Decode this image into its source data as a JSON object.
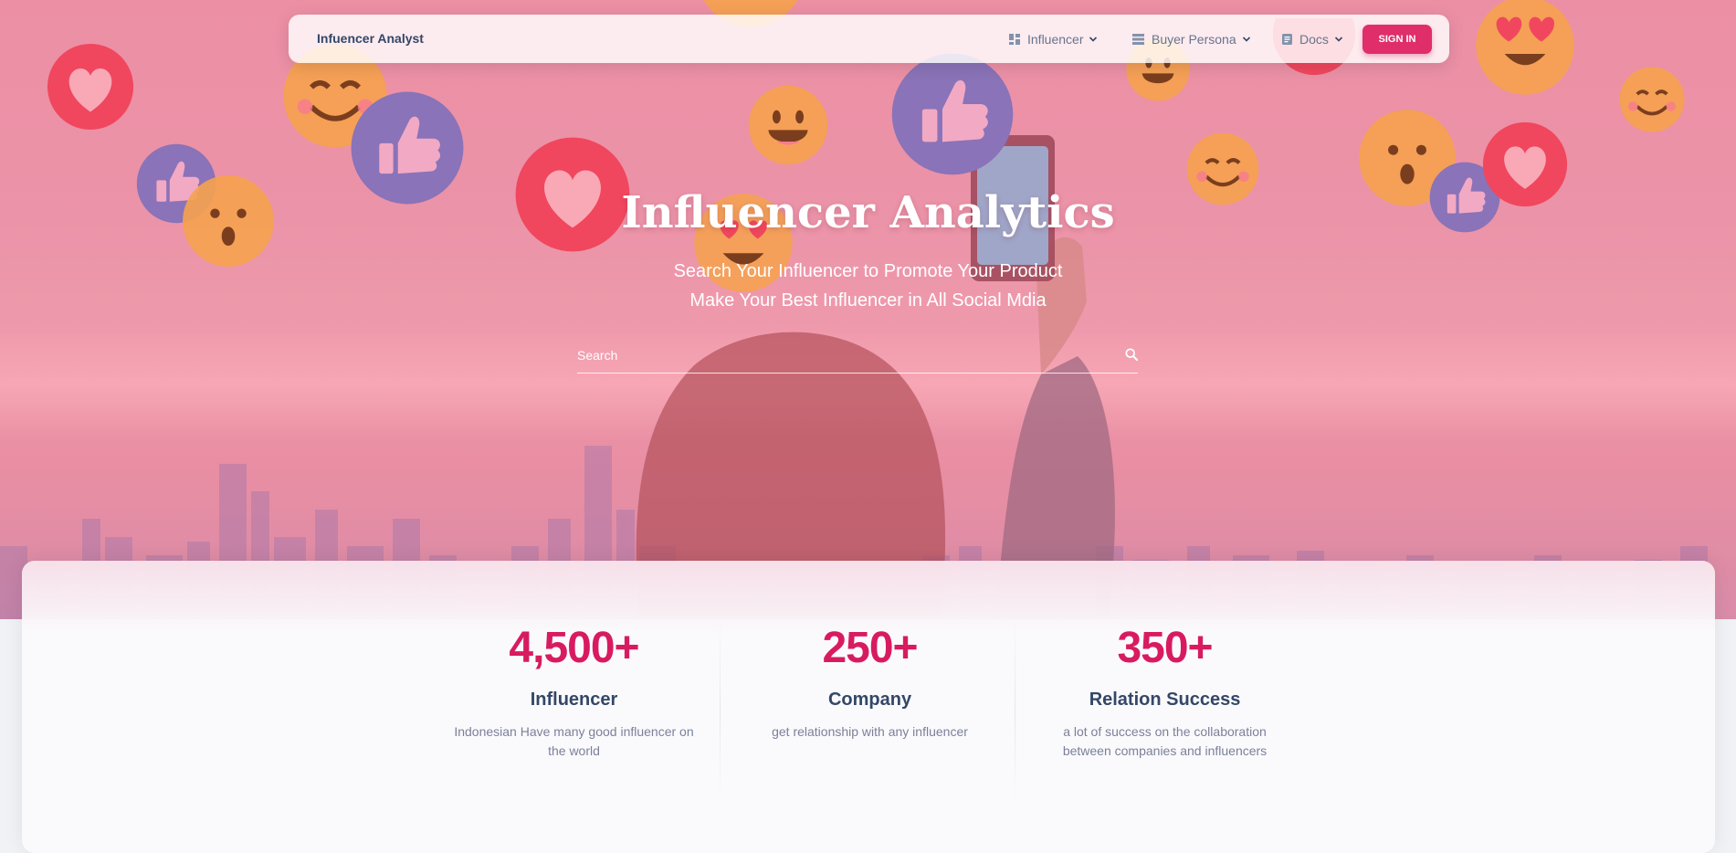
{
  "navbar": {
    "brand": "Infuencer Analyst",
    "items": [
      {
        "label": "Influencer",
        "icon": "dashboard-icon"
      },
      {
        "label": "Buyer Persona",
        "icon": "list-icon"
      },
      {
        "label": "Docs",
        "icon": "document-icon"
      }
    ],
    "signin_label": "SIGN IN"
  },
  "hero": {
    "title": "Influencer Analytics",
    "subtitle_line1": "Search Your Influencer to Promote Your Product",
    "subtitle_line2": "Make Your Best Influencer in All Social Mdia"
  },
  "search": {
    "placeholder": "Search",
    "icon": "search-icon"
  },
  "stats": [
    {
      "value": "4,500+",
      "label": "Influencer",
      "desc_line1": "Indonesian Have many good influencer on",
      "desc_line2": "the world"
    },
    {
      "value": "250+",
      "label": "Company",
      "desc_line1": "get relationship with any influencer",
      "desc_line2": ""
    },
    {
      "value": "350+",
      "label": "Relation Success",
      "desc_line1": "a lot of success on the collaboration",
      "desc_line2": "between companies and influencers"
    }
  ],
  "colors": {
    "accent": "#e02e6b",
    "stat_number": "#d81b60",
    "heading": "#344767",
    "muted": "#7b809a"
  }
}
